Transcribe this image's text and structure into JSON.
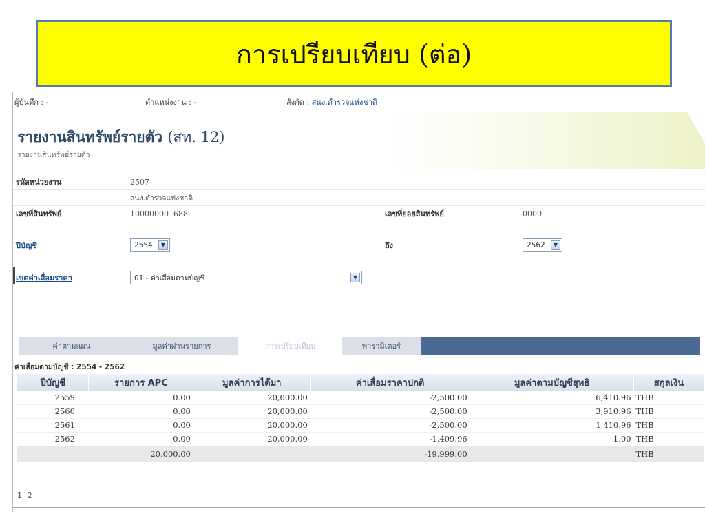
{
  "slide": {
    "title": "การเปรียบเทียบ (ต่อ)"
  },
  "userbar": {
    "recorder_label": "ผู้บันทึก : -",
    "position_label": "ตำแหน่งงาน : -",
    "org_label": "สังกัด :",
    "org_value": "สนง.ตำรวจแห่งชาติ"
  },
  "page": {
    "title": "รายงานสินทรัพย์รายตัว",
    "title_serial": "(สท. 12)",
    "subtitle": "รายงานสินทรัพย์รายตัว"
  },
  "form": {
    "unit_code_label": "รหัสหน่วยงาน",
    "unit_code_value": "2507",
    "unit_name_value": "สนง.ตำรวจแห่งชาติ",
    "asset_no_label": "เลขที่สินทรัพย์",
    "asset_no_value": "100000001688",
    "sub_asset_label": "เลขที่ย่อยสินทรัพย์",
    "sub_asset_value": "0000",
    "fiscal_year_label": "ปีบัญชี",
    "fiscal_year_from": "2554",
    "to_label": "ถึง",
    "fiscal_year_to": "2562",
    "depr_area_label": "เขตค่าเสื่อมราคา",
    "depr_area_value": "01 - ค่าเสื่อมตามบัญชี"
  },
  "tabs": [
    {
      "label": "ค่าตามแผน",
      "active": false
    },
    {
      "label": "มูลค่าผ่านรายการ",
      "active": false
    },
    {
      "label": "การเปรียบเทียบ",
      "active": true
    },
    {
      "label": "พารามิเตอร์",
      "active": false
    }
  ],
  "table": {
    "caption": "ค่าเสื่อมตามบัญชี : 2554 - 2562",
    "headers": [
      "ปีบัญชี",
      "รายการ APC",
      "มูลค่าการได้มา",
      "ค่าเสื่อมราคาปกติ",
      "มูลค่าตามบัญชีสุทธิ",
      "สกุลเงิน"
    ],
    "rows": [
      [
        "2559",
        "0.00",
        "20,000.00",
        "-2,500.00",
        "6,410.96",
        "THB"
      ],
      [
        "2560",
        "0.00",
        "20,000.00",
        "-2,500.00",
        "3,910.96",
        "THB"
      ],
      [
        "2561",
        "0.00",
        "20,000.00",
        "-2,500.00",
        "1,410.96",
        "THB"
      ],
      [
        "2562",
        "0.00",
        "20,000.00",
        "-1,409.96",
        "1.00",
        "THB"
      ]
    ],
    "total": [
      "",
      "20,000.00",
      "",
      "-19,999.00",
      "",
      "THB"
    ]
  },
  "pager": {
    "current": "1",
    "next": "2"
  },
  "colors": {
    "banner_bg": "#ffff00",
    "banner_border": "#4f7db3",
    "tab_bar": "#4a6a93",
    "link": "#1a4e8a"
  }
}
